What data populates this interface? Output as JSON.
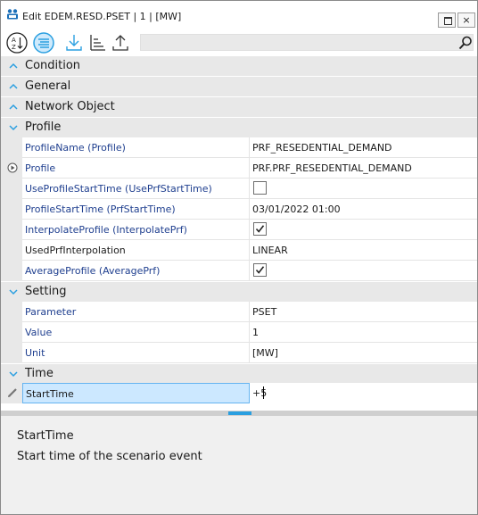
{
  "window": {
    "title": "Edit EDEM.RESD.PSET | 1 | [MW]",
    "maximize_label": "□",
    "close_label": "×"
  },
  "toolbar": {
    "buttons": [
      {
        "icon": "sort-alphabetical-icon",
        "active": false
      },
      {
        "icon": "categorized-view-icon",
        "active": true
      },
      {
        "icon": "import-icon",
        "active": false
      },
      {
        "icon": "sort-hierarchy-icon",
        "active": false
      },
      {
        "icon": "export-icon",
        "active": false
      }
    ],
    "search": {
      "value": "",
      "placeholder": "",
      "icon": "search-icon"
    }
  },
  "categories": {
    "condition": "Condition",
    "general": "General",
    "network_object": "Network Object",
    "profile": "Profile",
    "setting": "Setting",
    "time": "Time"
  },
  "profile_rows": [
    {
      "name": "ProfileName (Profile)",
      "value": "PRF_RESEDENTIAL_DEMAND"
    },
    {
      "name": "Profile",
      "value": "PRF.PRF_RESEDENTIAL_DEMAND"
    },
    {
      "name": "UseProfileStartTime (UsePrfStartTime)",
      "checked": false
    },
    {
      "name": "ProfileStartTime (PrfStartTime)",
      "value": "03/01/2022 01:00"
    },
    {
      "name": "InterpolateProfile (InterpolatePrf)",
      "checked": true
    },
    {
      "name": "UsedPrfInterpolation",
      "value": "LINEAR"
    },
    {
      "name": "AverageProfile (AveragePrf)",
      "checked": true
    }
  ],
  "setting_rows": [
    {
      "name": "Parameter",
      "value": "PSET"
    },
    {
      "name": "Value",
      "value": "1"
    },
    {
      "name": "Unit",
      "value": "[MW]"
    }
  ],
  "time_rows": [
    {
      "name": "StartTime",
      "value": "+5"
    }
  ],
  "description": {
    "title": "StartTime",
    "text": "Start time of the scenario event"
  },
  "colors": {
    "accent": "#2a9fe0",
    "category_bg": "#e8e8e8",
    "property_name": "#1f3f8f",
    "selection": "#cce8ff"
  }
}
